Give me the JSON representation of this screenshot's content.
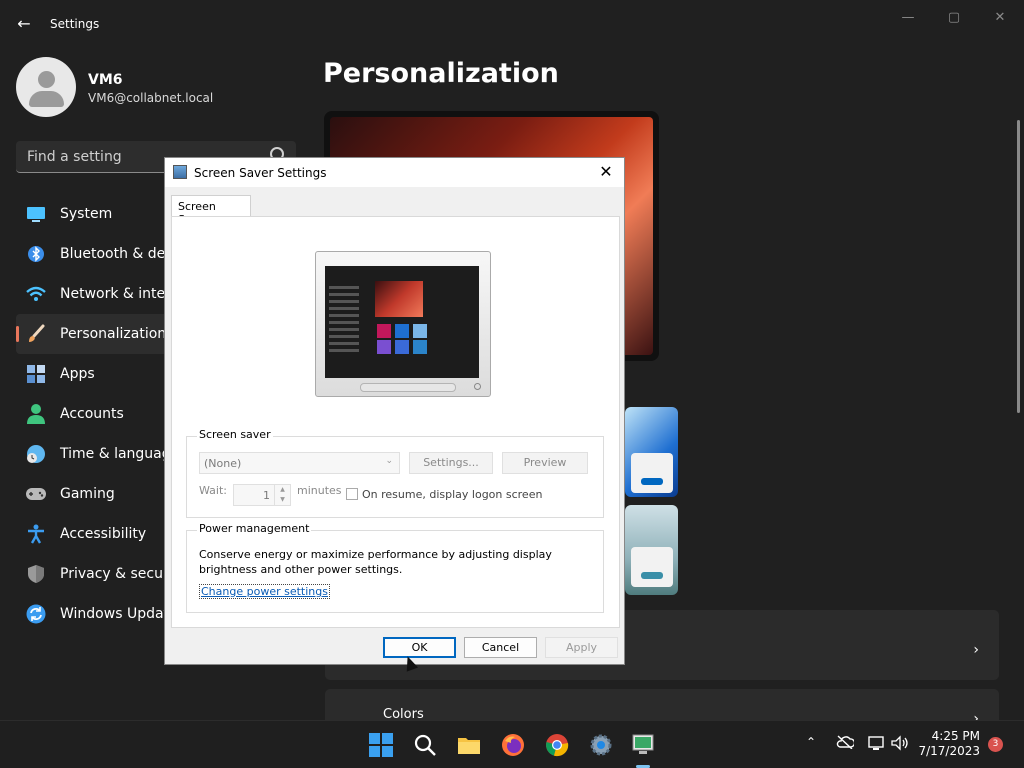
{
  "window": {
    "title": "Settings",
    "controls": {
      "minimize": "—",
      "maximize": "▢",
      "close": "✕"
    }
  },
  "profile": {
    "name": "VM6",
    "email": "VM6@collabnet.local"
  },
  "search": {
    "placeholder": "Find a setting"
  },
  "sidebar": {
    "items": [
      {
        "label": "System",
        "icon": "monitor-icon",
        "color": "#4cc2ff"
      },
      {
        "label": "Bluetooth & devices",
        "icon": "bluetooth-icon",
        "color": "#3b8eea"
      },
      {
        "label": "Network & internet",
        "icon": "wifi-icon",
        "color": "#4cc2ff"
      },
      {
        "label": "Personalization",
        "icon": "brush-icon",
        "color": "#f0a35e"
      },
      {
        "label": "Apps",
        "icon": "apps-icon",
        "color": "#8fb8e8"
      },
      {
        "label": "Accounts",
        "icon": "person-icon",
        "color": "#3fc57f"
      },
      {
        "label": "Time & language",
        "icon": "globe-clock-icon",
        "color": "#5fb7f0"
      },
      {
        "label": "Gaming",
        "icon": "gamepad-icon",
        "color": "#b9b9b9"
      },
      {
        "label": "Accessibility",
        "icon": "accessibility-icon",
        "color": "#3b9cf0"
      },
      {
        "label": "Privacy & security",
        "icon": "shield-icon",
        "color": "#9a9a9a"
      },
      {
        "label": "Windows Update",
        "icon": "update-icon",
        "color": "#3b9cf0"
      }
    ],
    "active_index": 3,
    "accent": "#e8765b"
  },
  "main": {
    "title": "Personalization",
    "colors_card": {
      "label": "Colors"
    }
  },
  "dialog": {
    "title": "Screen Saver Settings",
    "close": "✕",
    "tab": "Screen Saver",
    "screen_saver": {
      "group_label": "Screen saver",
      "selected": "(None)",
      "settings_btn": "Settings...",
      "preview_btn": "Preview",
      "wait_label": "Wait:",
      "wait_value": "1",
      "minutes_label": "minutes",
      "resume_label": "On resume, display logon screen"
    },
    "power": {
      "group_label": "Power management",
      "text": "Conserve energy or maximize performance by adjusting display brightness and other power settings.",
      "link": "Change power settings"
    },
    "buttons": {
      "ok": "OK",
      "cancel": "Cancel",
      "apply": "Apply"
    }
  },
  "taskbar": {
    "time": "4:25 PM",
    "date": "7/17/2023",
    "notification_count": "3",
    "apps": [
      "start-icon",
      "search-icon",
      "file-explorer-icon",
      "firefox-icon",
      "chrome-icon",
      "settings-icon",
      "screen-saver-icon"
    ]
  }
}
